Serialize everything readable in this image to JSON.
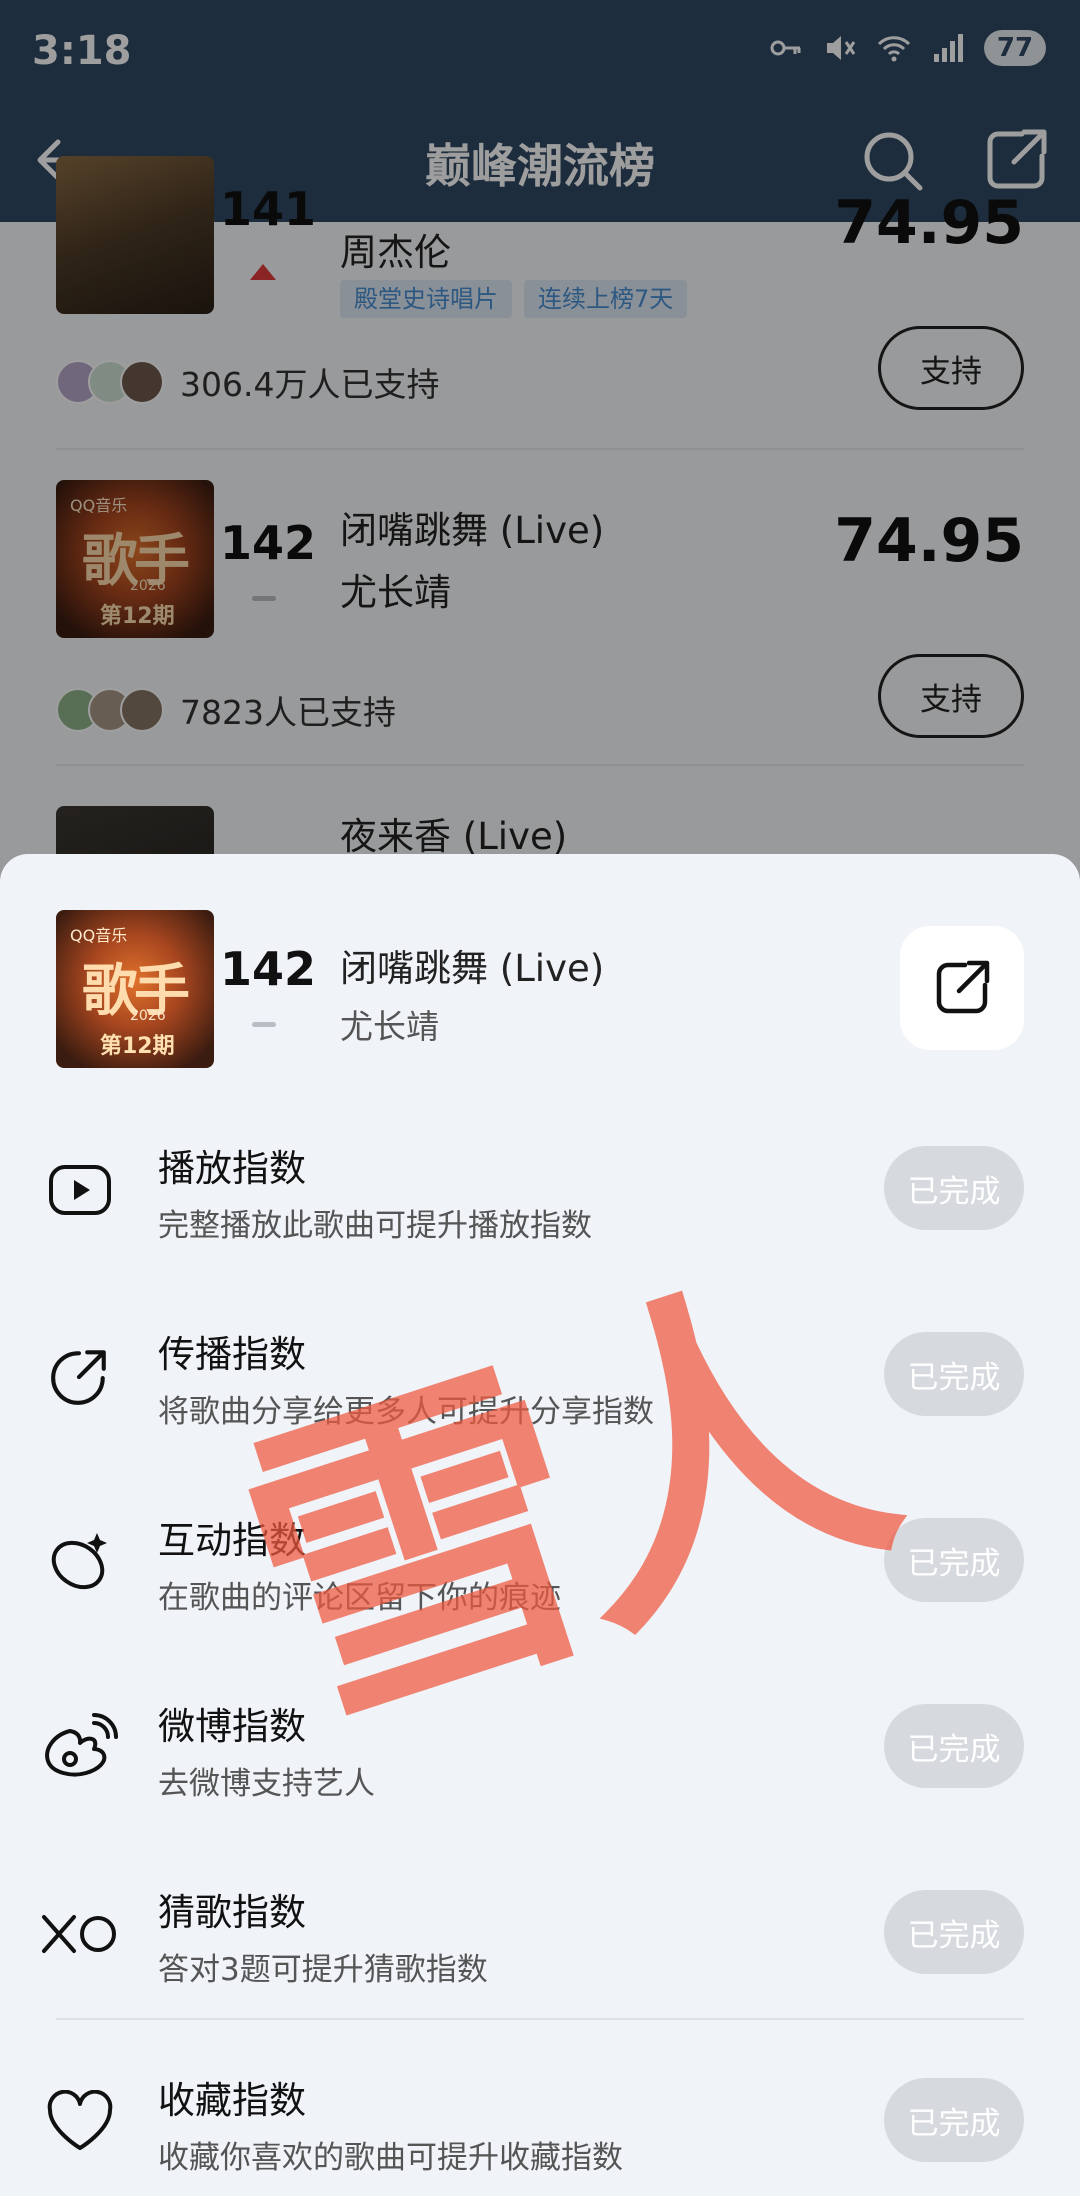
{
  "status_bar": {
    "time": "3:18",
    "battery": "77"
  },
  "nav": {
    "title": "巅峰潮流榜"
  },
  "background_list": [
    {
      "rank": "141",
      "artist": "周杰伦",
      "score": "74.95",
      "tags": [
        "殿堂史诗唱片",
        "连续上榜7天"
      ],
      "supporters": "306.4万人已支持",
      "support_label": "支持"
    },
    {
      "rank": "142",
      "title": "闭嘴跳舞 (Live)",
      "artist": "尤长靖",
      "score": "74.95",
      "supporters": "7823人已支持",
      "support_label": "支持"
    },
    {
      "title": "夜来香 (Live)"
    }
  ],
  "cover_art": {
    "brand": "QQ音乐",
    "show": "歌手",
    "year": "2026",
    "episode": "第12期"
  },
  "sheet": {
    "rank": "142",
    "title": "闭嘴跳舞 (Live)",
    "artist": "尤长靖",
    "tasks": [
      {
        "icon": "play-icon",
        "title": "播放指数",
        "desc": "完整播放此歌曲可提升播放指数",
        "status": "已完成"
      },
      {
        "icon": "share-icon",
        "title": "传播指数",
        "desc": "将歌曲分享给更多人可提升分享指数",
        "status": "已完成"
      },
      {
        "icon": "comment-icon",
        "title": "互动指数",
        "desc": "在歌曲的评论区留下你的痕迹",
        "status": "已完成"
      },
      {
        "icon": "weibo-icon",
        "title": "微博指数",
        "desc": "去微博支持艺人",
        "status": "已完成"
      },
      {
        "icon": "xo-icon",
        "title": "猜歌指数",
        "desc": "答对3题可提升猜歌指数",
        "status": "已完成"
      },
      {
        "icon": "heart-icon",
        "title": "收藏指数",
        "desc": "收藏你喜欢的歌曲可提升收藏指数",
        "status": "已完成"
      }
    ]
  },
  "watermark": "雪人",
  "colors": {
    "nav_bg": "#2f4a63",
    "tag_bg": "#dde9f6",
    "tag_text": "#4a8fd1",
    "done_btn": "#d6d9de",
    "watermark": "#f0583f"
  }
}
